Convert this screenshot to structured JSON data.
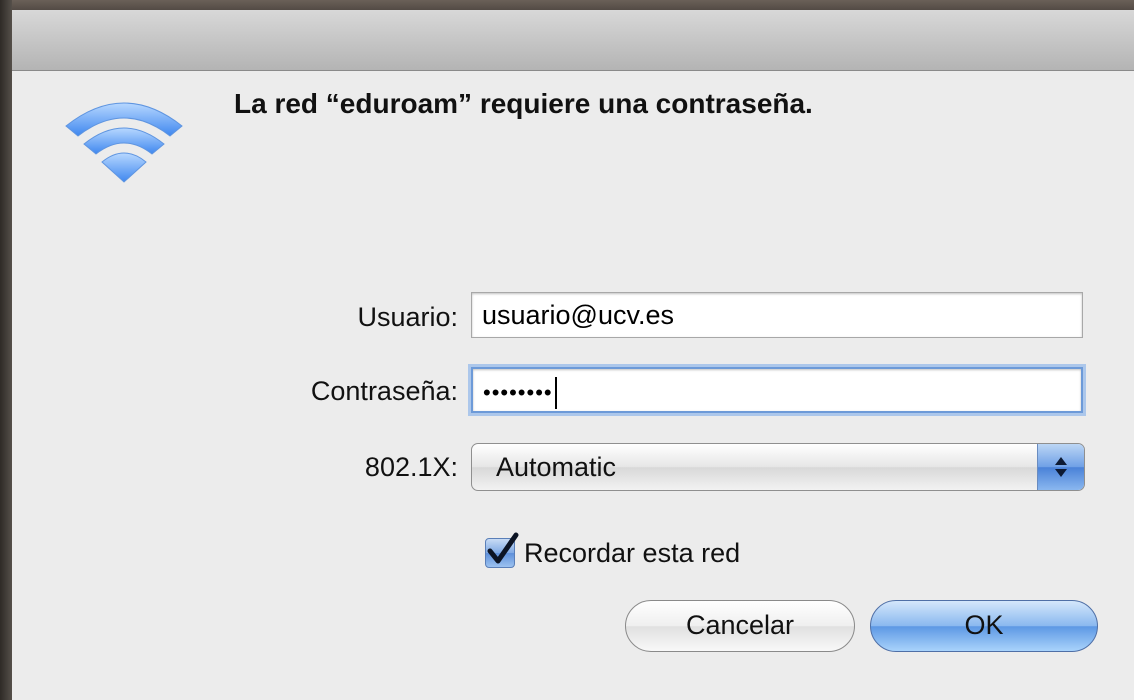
{
  "dialog": {
    "title": "La red “eduroam” requiere una contraseña.",
    "icon": "wifi-icon"
  },
  "form": {
    "username_label": "Usuario:",
    "username_value": "usuario@ucv.es",
    "password_label": "Contraseña:",
    "password_mask": "••••••••",
    "security_label": "802.1X:",
    "security_value": "Automatic",
    "remember_label": "Recordar esta red",
    "remember_checked": true
  },
  "buttons": {
    "cancel": "Cancelar",
    "ok": "OK"
  },
  "colors": {
    "accent": "#5d98e4",
    "focus_ring": "#6d9ad8"
  }
}
